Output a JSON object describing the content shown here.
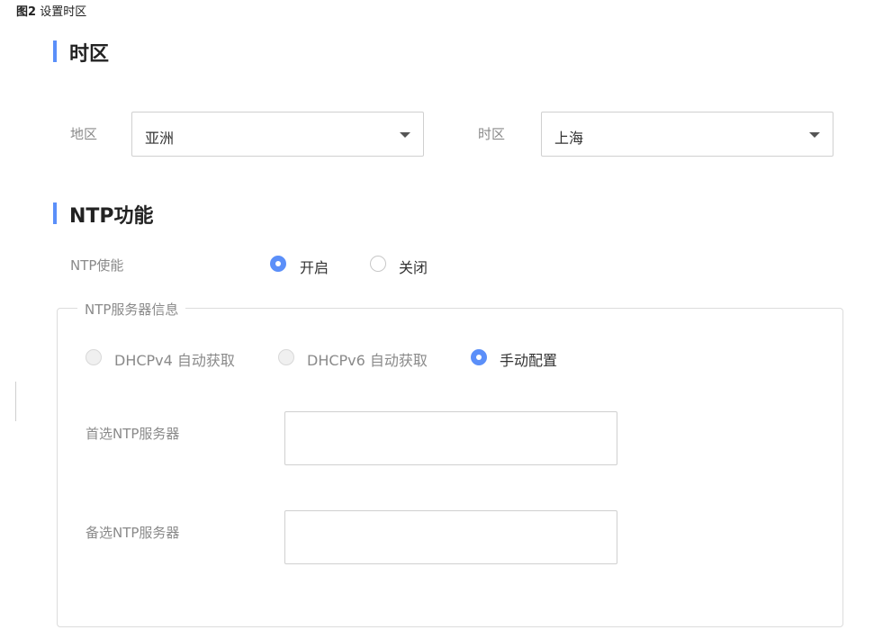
{
  "figure_caption": {
    "number": "图2",
    "text": "设置时区"
  },
  "timezone_section": {
    "title": "时区",
    "region_label": "地区",
    "region_value": "亚洲",
    "timezone_label": "时区",
    "timezone_value": "上海"
  },
  "ntp_section": {
    "title": "NTP功能",
    "enable_label": "NTP使能",
    "enable_options": [
      {
        "label": "开启",
        "checked": true
      },
      {
        "label": "关闭",
        "checked": false
      }
    ],
    "server_info": {
      "legend": "NTP服务器信息",
      "source_options": [
        {
          "label": "DHCPv4 自动获取",
          "checked": false,
          "disabled": true
        },
        {
          "label": "DHCPv6 自动获取",
          "checked": false,
          "disabled": true
        },
        {
          "label": "手动配置",
          "checked": true,
          "disabled": false
        }
      ],
      "primary_label": "首选NTP服务器",
      "primary_value": "",
      "secondary_label": "备选NTP服务器",
      "secondary_value": ""
    }
  },
  "colors": {
    "accent": "#5b8ff9",
    "label": "#8a8a8a",
    "border": "#d0d0d0"
  }
}
